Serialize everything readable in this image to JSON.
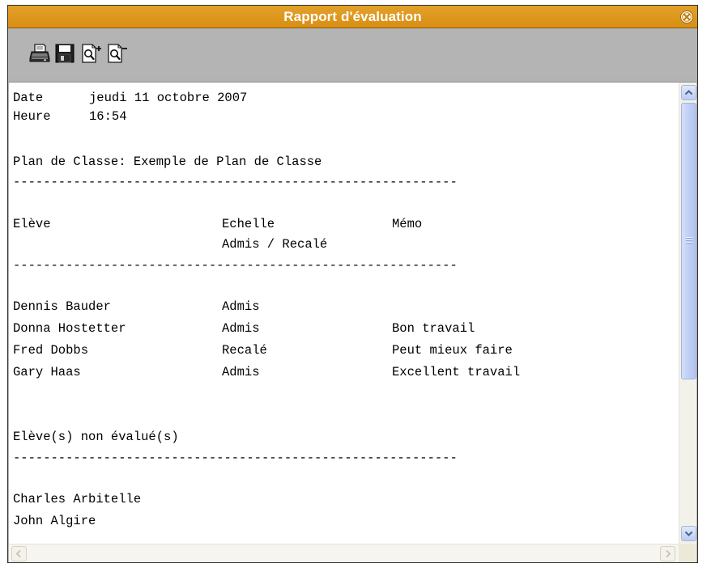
{
  "window": {
    "title": "Rapport d'évaluation",
    "title_bar_color": "#DC9318",
    "toolbar_color": "#B4B4B4"
  },
  "toolbar": {
    "icons": [
      "printer-icon",
      "save-icon",
      "zoom-in-icon",
      "zoom-out-icon"
    ]
  },
  "report": {
    "date_label": "Date",
    "date_value": "jeudi 11 octobre 2007",
    "time_label": "Heure",
    "time_value": "16:54",
    "plan_line": "Plan de Classe: Exemple de Plan de Classe",
    "separator": "-----------------------------------------------------------",
    "columns": {
      "student": "Elève",
      "scale": "Echelle",
      "memo": "Mémo",
      "scale_sub": "Admis / Recalé"
    },
    "rows": [
      {
        "student": "Dennis Bauder",
        "result": "Admis",
        "memo": ""
      },
      {
        "student": "Donna Hostetter",
        "result": "Admis",
        "memo": "Bon travail"
      },
      {
        "student": "Fred Dobbs",
        "result": "Recalé",
        "memo": "Peut mieux faire"
      },
      {
        "student": "Gary Haas",
        "result": "Admis",
        "memo": "Excellent travail"
      }
    ],
    "not_evaluated_heading": "Elève(s) non évalué(s)",
    "not_evaluated": [
      "Charles Arbitelle",
      "John Algire"
    ]
  }
}
